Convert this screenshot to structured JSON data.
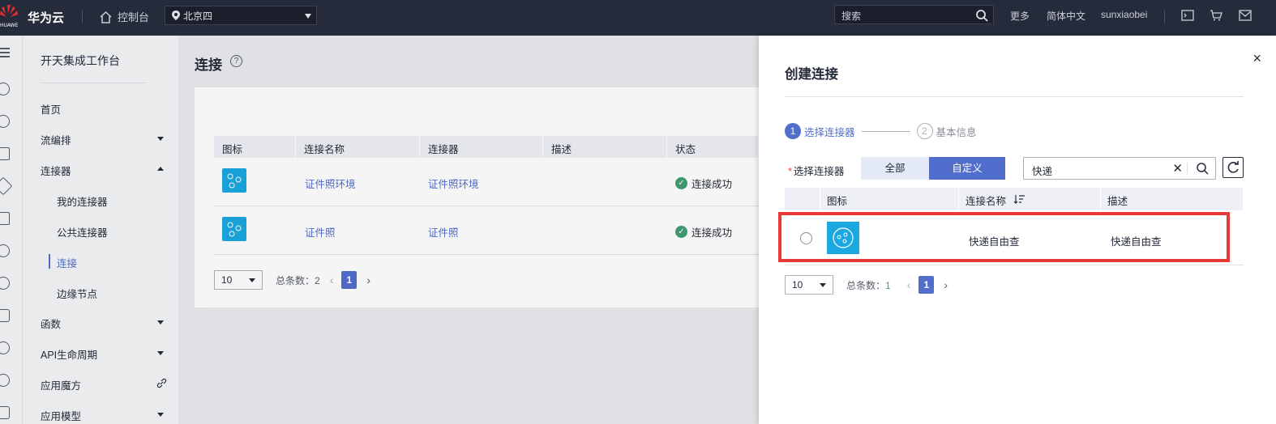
{
  "topbar": {
    "brand": "华为云",
    "console": "控制台",
    "region": "北京四",
    "search_placeholder": "搜索",
    "more": "更多",
    "language": "简体中文",
    "username": "sunxiaobei"
  },
  "sidebar": {
    "title": "开天集成工作台",
    "items": [
      {
        "label": "首页"
      },
      {
        "label": "流编排"
      },
      {
        "label": "连接器"
      },
      {
        "label": "我的连接器"
      },
      {
        "label": "公共连接器"
      },
      {
        "label": "连接"
      },
      {
        "label": "边缘节点"
      },
      {
        "label": "函数"
      },
      {
        "label": "API生命周期"
      },
      {
        "label": "应用魔方"
      },
      {
        "label": "应用模型"
      }
    ]
  },
  "main": {
    "title": "连接",
    "table": {
      "headers": [
        "图标",
        "连接名称",
        "连接器",
        "描述",
        "状态"
      ],
      "rows": [
        {
          "name": "证件照环境",
          "connector": "证件照环境",
          "description": "",
          "status": "连接成功"
        },
        {
          "name": "证件照",
          "connector": "证件照",
          "description": "",
          "status": "连接成功"
        }
      ]
    },
    "pager": {
      "page_size": "10",
      "total_label": "总条数：2",
      "current_page": "1"
    }
  },
  "drawer": {
    "title": "创建连接",
    "close": "×",
    "steps": [
      {
        "num": "1",
        "label": "选择连接器"
      },
      {
        "num": "2",
        "label": "基本信息"
      }
    ],
    "field_label": "选择连接器",
    "required_mark": "*",
    "filter_all": "全部",
    "filter_custom": "自定义",
    "search_value": "快递",
    "table": {
      "headers": [
        "图标",
        "连接名称",
        "描述"
      ],
      "rows": [
        {
          "name": "快递自由查",
          "description": "快递自由查"
        }
      ]
    },
    "pager": {
      "page_size": "10",
      "total_prefix": "总条数：",
      "total_count": "1",
      "current_page": "1"
    }
  },
  "colors": {
    "topbar": "#252b3a",
    "accent": "#526ecc",
    "success": "#3f9e74",
    "highlight_box": "#e83a3a",
    "app_icon": "#1ba7e0"
  }
}
